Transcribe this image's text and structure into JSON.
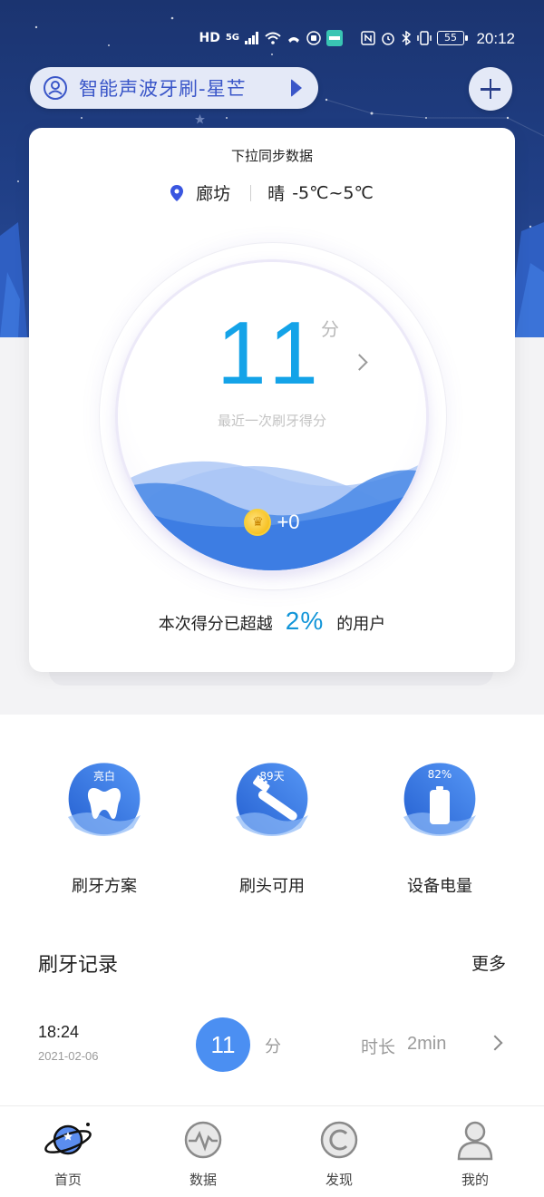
{
  "status_bar": {
    "icons": [
      "HD",
      "5G",
      "signal-icon",
      "wifi-icon",
      "call-icon",
      "hand-icon",
      "boss-app-icon",
      "nfc-icon",
      "alarm-icon",
      "bluetooth-icon",
      "vibrate-icon"
    ],
    "hd_label": "HD",
    "network_label": "5G",
    "battery": "55",
    "time": "20:12"
  },
  "header": {
    "device_name": "智能声波牙刷-星芒",
    "add_icon": "plus-icon"
  },
  "card": {
    "sync_hint": "下拉同步数据",
    "city": "廊坊",
    "weather": "晴",
    "temperature": "-5℃~5℃",
    "score": "11",
    "score_unit": "分",
    "score_caption": "最近一次刷牙得分",
    "coins": "+0",
    "exceed_prefix": "本次得分已超越",
    "exceed_percent": "2%",
    "exceed_suffix": "的用户"
  },
  "features": [
    {
      "badge": "亮白",
      "label": "刷牙方案",
      "icon": "tooth-icon"
    },
    {
      "badge": "89天",
      "label": "刷头可用",
      "icon": "brush-head-icon"
    },
    {
      "badge": "82%",
      "label": "设备电量",
      "icon": "battery-icon"
    }
  ],
  "records": {
    "title": "刷牙记录",
    "more": "更多",
    "items": [
      {
        "time": "18:24",
        "date": "2021-02-06",
        "score": "11",
        "score_unit": "分",
        "duration_label": "时长",
        "duration": "2min"
      }
    ]
  },
  "nav": [
    {
      "label": "首页",
      "icon": "planet-icon",
      "active": true
    },
    {
      "label": "数据",
      "icon": "pulse-icon",
      "active": false
    },
    {
      "label": "发现",
      "icon": "discover-icon",
      "active": false
    },
    {
      "label": "我的",
      "icon": "profile-icon",
      "active": false
    }
  ],
  "colors": {
    "header_bg": "#203f86",
    "score_blue": "#14a3e8",
    "accent": "#3a56c8",
    "wave": "#3d7de3",
    "record_badge": "#4b8ff2"
  }
}
